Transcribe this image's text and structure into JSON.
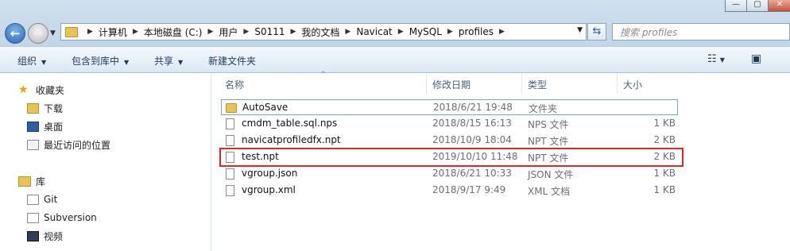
{
  "window": {
    "controls": [
      "—",
      "▢"
    ]
  },
  "nav": {
    "back_icon": "back-arrow-icon",
    "forward_icon": "forward-arrow-icon"
  },
  "address": {
    "crumbs": [
      "计算机",
      "本地磁盘 (C:)",
      "用户",
      "S0111",
      "我的文档",
      "Navicat",
      "MySQL",
      "profiles"
    ]
  },
  "search": {
    "placeholder": "搜索 profiles"
  },
  "toolbar": {
    "organize": "组织",
    "include_in_library": "包含到库中",
    "share": "共享",
    "new_folder": "新建文件夹"
  },
  "sidebar": {
    "favorites": "收藏夹",
    "downloads": "下载",
    "desktop": "桌面",
    "recent": "最近访问的位置",
    "libraries": "库",
    "git": "Git",
    "subversion": "Subversion",
    "videos": "视频"
  },
  "columns": {
    "name": "名称",
    "date": "修改日期",
    "type": "类型",
    "size": "大小"
  },
  "files": [
    {
      "name": "AutoSave",
      "date": "2018/6/21 19:48",
      "type": "文件夹",
      "size": "",
      "icon": "folder-icon"
    },
    {
      "name": "cmdm_table.sql.nps",
      "date": "2018/8/15 16:13",
      "type": "NPS 文件",
      "size": "1 KB",
      "icon": "file-icon"
    },
    {
      "name": "navicatprofiledfx.npt",
      "date": "2018/10/9 18:04",
      "type": "NPT 文件",
      "size": "2 KB",
      "icon": "file-icon"
    },
    {
      "name": "test.npt",
      "date": "2019/10/10 11:48",
      "type": "NPT 文件",
      "size": "2 KB",
      "icon": "file-icon"
    },
    {
      "name": "vgroup.json",
      "date": "2018/6/21 10:33",
      "type": "JSON 文件",
      "size": "1 KB",
      "icon": "file-icon"
    },
    {
      "name": "vgroup.xml",
      "date": "2018/9/17 9:49",
      "type": "XML 文档",
      "size": "1 KB",
      "icon": "file-icon"
    }
  ],
  "colors": {
    "highlight": "#d9292a",
    "toolbar_text": "#1e395b"
  }
}
